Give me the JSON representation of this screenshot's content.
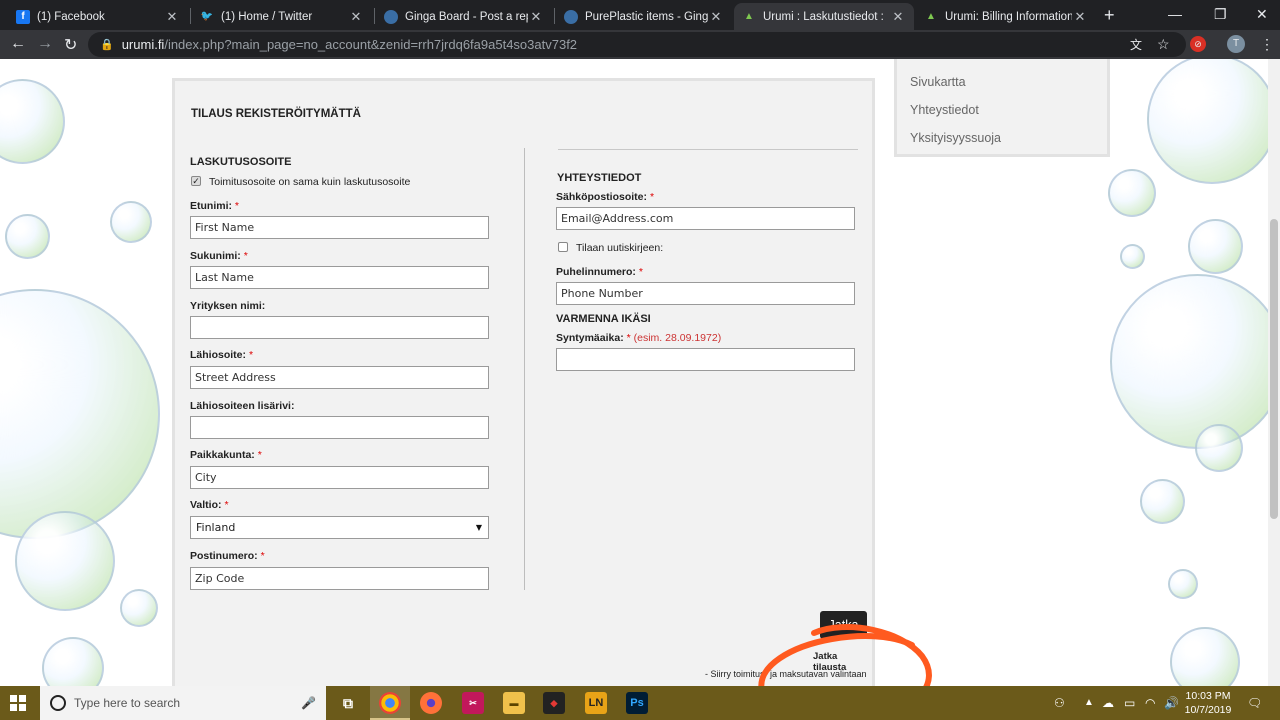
{
  "browser": {
    "tabs": [
      {
        "title": "(1) Facebook",
        "icon": "facebook-icon",
        "color": "#1877f2"
      },
      {
        "title": "(1) Home / Twitter",
        "icon": "twitter-icon",
        "color": "#1da1f2"
      },
      {
        "title": "Ginga Board - Post a reply",
        "icon": "ginga-board-icon",
        "color": "#3a6ea5"
      },
      {
        "title": "PurePlastic items - Ginga Bo",
        "icon": "ginga-board-icon",
        "color": "#3a6ea5"
      },
      {
        "title": "Urumi : Laskutustiedot :",
        "icon": "urumi-icon",
        "color": "#3f7d2a"
      },
      {
        "title": "Urumi: Billing Information:",
        "icon": "urumi-icon",
        "color": "#3f7d2a"
      }
    ],
    "active_tab_index": 4,
    "url_host": "urumi.fi",
    "url_path": "/index.php?main_page=no_account&zenid=rrh7jrdq6fa9a5t4so3atv73f2",
    "profile_initial": "T"
  },
  "form": {
    "title": "TILAUS REKISTERÖITYMÄTTÄ",
    "billing": {
      "heading": "LASKUTUSOSOITE",
      "same_address_label": "Toimitusosoite on sama kuin laskutusosoite",
      "same_address_checked": true,
      "fields": [
        {
          "label": "Etunimi:",
          "required": "*",
          "placeholder": "First Name"
        },
        {
          "label": "Sukunimi:",
          "required": "*",
          "placeholder": "Last Name"
        },
        {
          "label": "Yrityksen nimi:",
          "required": "",
          "placeholder": ""
        },
        {
          "label": "Lähiosoite:",
          "required": "*",
          "placeholder": "Street Address"
        },
        {
          "label": "Lähiosoiteen lisärivi:",
          "required": "",
          "placeholder": ""
        },
        {
          "label": "Paikkakunta:",
          "required": "*",
          "placeholder": "City"
        },
        {
          "label": "Valtio:",
          "required": "*",
          "value": "Finland"
        },
        {
          "label": "Postinumero:",
          "required": "*",
          "placeholder": "Zip Code"
        }
      ]
    },
    "contact": {
      "heading": "YHTEYSTIEDOT",
      "email_label": "Sähköpostiosoite:",
      "email_required": "*",
      "email_placeholder": "Email@Address.com",
      "newsletter_label": "Tilaan uutiskirjeen:",
      "newsletter_checked": false,
      "phone_label": "Puhelinnumero:",
      "phone_required": "*",
      "phone_placeholder": "Phone Number"
    },
    "age": {
      "heading": "VARMENNA IKÄSI",
      "dob_label": "Syntymäaika:",
      "dob_required": "*",
      "dob_hint": "(esim. 28.09.1972)"
    },
    "continue_button": "Jatka",
    "continue_label": "Jatka tilausta",
    "continue_note": "- Siirry toimitus- ja maksutavan valintaan"
  },
  "sidebar": {
    "links": [
      "Sivukartta",
      "Yhteystiedot",
      "Yksityisyyssuoja"
    ]
  },
  "taskbar": {
    "search_placeholder": "Type here to search",
    "time": "10:03 PM",
    "date": "10/7/2019",
    "apps": [
      "task-view",
      "chrome",
      "firefox",
      "snipping-tool",
      "file-explorer",
      "game-app",
      "LN",
      "Ps"
    ]
  },
  "colors": {
    "accent_required": "#dd0000",
    "annotation": "#ff5a1f",
    "taskbar": "#6b5a1a"
  }
}
